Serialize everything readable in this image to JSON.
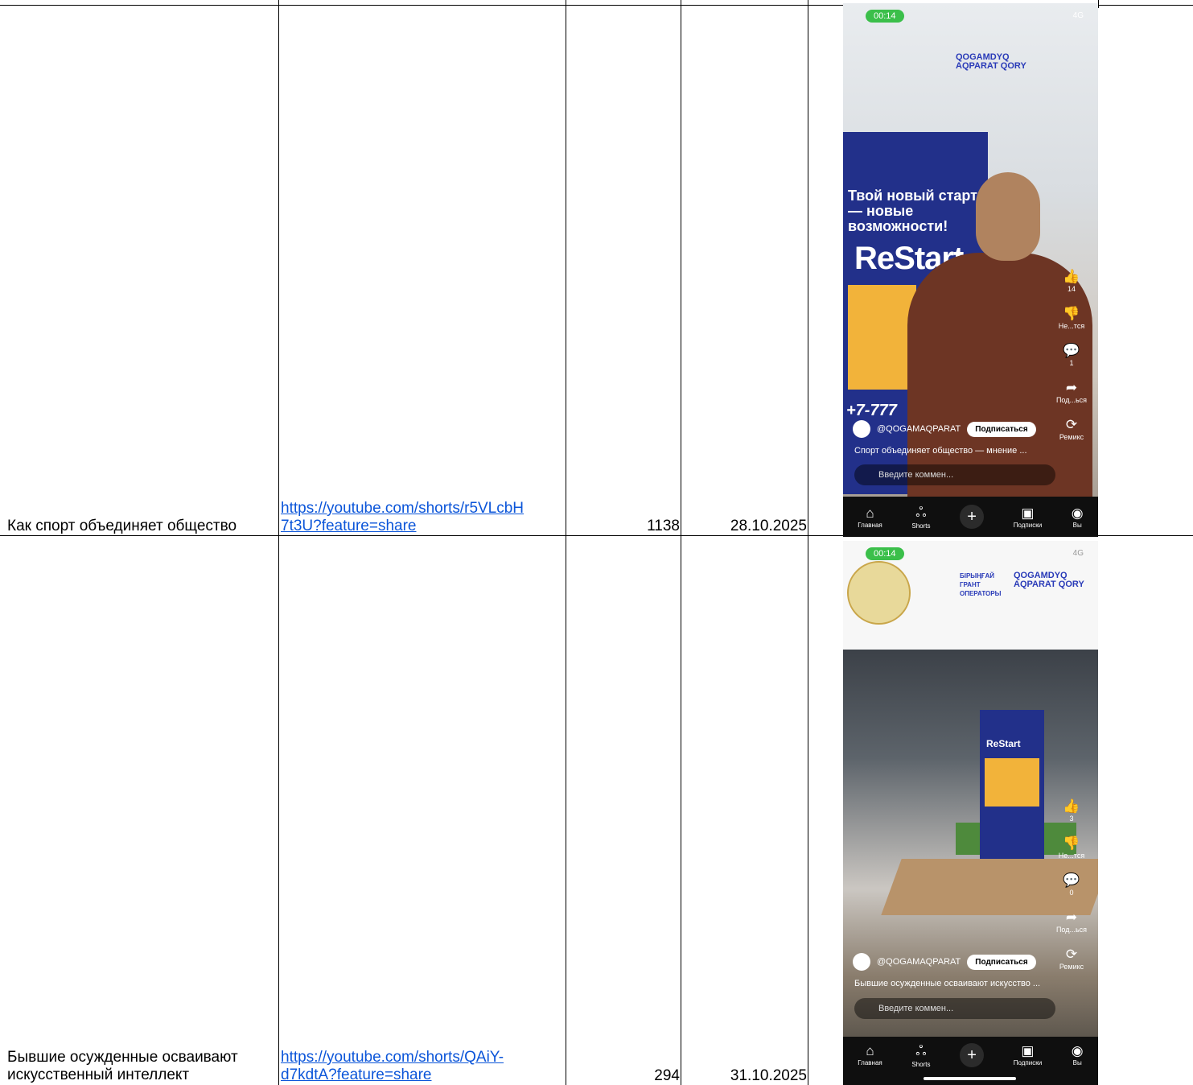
{
  "rows": [
    {
      "title": "Как спорт объединяет общество",
      "link_line1": "https://youtube.com/shorts/r5VLcbH",
      "link_line2": "7t3U?feature=share",
      "views": "1138",
      "date": "28.10.2025",
      "screenshot": {
        "timer": "00:14",
        "status": "4G",
        "brand": "QOGAMDYQ AQPARAT QORY",
        "banner_text": "Твой новый старт — новые возможности!",
        "banner_logo": "ReStart",
        "phone": "+7-777",
        "rail": [
          {
            "icon": "👍",
            "label": "14"
          },
          {
            "icon": "👎",
            "label": "Не...тся"
          },
          {
            "icon": "💬",
            "label": "1"
          },
          {
            "icon": "➦",
            "label": "Под...ься"
          },
          {
            "icon": "⟳",
            "label": "Ремикс"
          }
        ],
        "channel": "@QOGAMAQPARAT",
        "subscribe": "Подписаться",
        "caption": "Спорт объединяет общество — мнение ...",
        "comment_placeholder": "Введите коммен...",
        "nav": [
          {
            "icon": "⌂",
            "label": "Главная"
          },
          {
            "icon": "ஃ",
            "label": "Shorts"
          },
          {
            "icon": "▣",
            "label": "Подписки"
          },
          {
            "icon": "◉",
            "label": "Вы"
          }
        ]
      }
    },
    {
      "title": "Бывшие осужденные осваивают искусственный интеллект",
      "link_line1": "https://youtube.com/shorts/QAiY-",
      "link_line2": "d7kdtA?feature=share",
      "views": "294",
      "date": "31.10.2025",
      "screenshot": {
        "timer": "00:14",
        "status": "4G",
        "brand": "QOGAMDYQ AQPARAT QORY",
        "grant_text": "БІРЫҢҒАЙ ГРАНТ ОПЕРАТОРЫ",
        "banner_logo": "ReStart",
        "rail": [
          {
            "icon": "👍",
            "label": "3"
          },
          {
            "icon": "👎",
            "label": "Не...тся"
          },
          {
            "icon": "💬",
            "label": "0"
          },
          {
            "icon": "➦",
            "label": "Под...ься"
          },
          {
            "icon": "⟳",
            "label": "Ремикс"
          }
        ],
        "channel": "@QOGAMAQPARAT",
        "subscribe": "Подписаться",
        "caption": "Бывшие осужденные осваивают искусство ...",
        "comment_placeholder": "Введите коммен...",
        "nav": [
          {
            "icon": "⌂",
            "label": "Главная"
          },
          {
            "icon": "ஃ",
            "label": "Shorts"
          },
          {
            "icon": "▣",
            "label": "Подписки"
          },
          {
            "icon": "◉",
            "label": "Вы"
          }
        ]
      }
    }
  ]
}
